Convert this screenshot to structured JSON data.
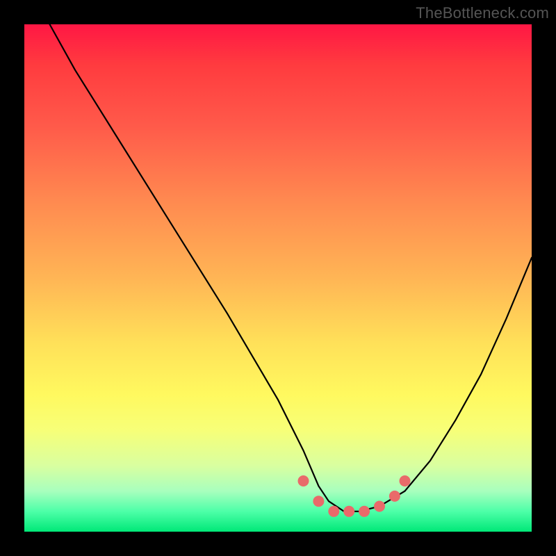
{
  "watermark": "TheBottleneck.com",
  "chart_data": {
    "type": "line",
    "title": "",
    "xlabel": "",
    "ylabel": "",
    "xlim": [
      0,
      100
    ],
    "ylim": [
      0,
      100
    ],
    "series": [
      {
        "name": "curve",
        "color": "#000000",
        "x": [
          5,
          10,
          20,
          30,
          40,
          50,
          55,
          58,
          60,
          63,
          66,
          70,
          75,
          80,
          85,
          90,
          95,
          100
        ],
        "values": [
          100,
          91,
          75,
          59,
          43,
          26,
          16,
          9,
          6,
          4,
          4,
          5,
          8,
          14,
          22,
          31,
          42,
          54
        ]
      }
    ],
    "annotations": {
      "dots": {
        "color": "#e96a6a",
        "radius_px": 8,
        "points_xy": [
          [
            55,
            10
          ],
          [
            58,
            6
          ],
          [
            61,
            4
          ],
          [
            64,
            4
          ],
          [
            67,
            4
          ],
          [
            70,
            5
          ],
          [
            73,
            7
          ],
          [
            75,
            10
          ]
        ]
      }
    }
  }
}
